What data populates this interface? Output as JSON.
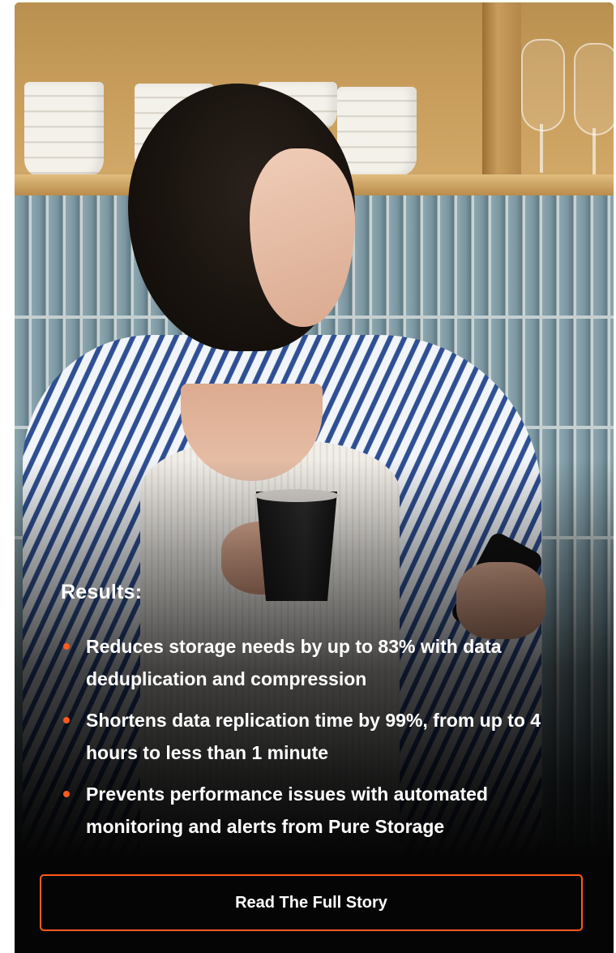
{
  "card": {
    "photo_icon": "woman-with-coffee-photo",
    "accent_color": "#ff5a1f",
    "overlay_color": "#050505"
  },
  "results": {
    "heading": "Results:",
    "items": [
      {
        "text": "Reduces storage needs by up to 83% with data deduplication and compression"
      },
      {
        "text": "Shortens data replication time by 99%, from up to 4 hours to less than 1 minute"
      },
      {
        "text": "Prevents performance issues with automated monitoring and alerts from Pure Storage"
      }
    ]
  },
  "cta": {
    "label": "Read The Full Story"
  }
}
